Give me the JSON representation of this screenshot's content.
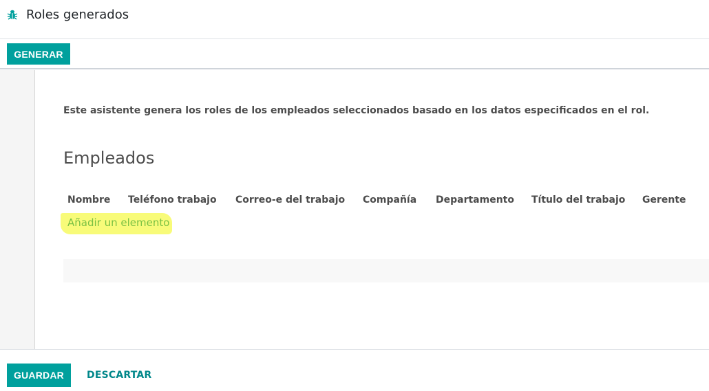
{
  "header": {
    "title": "Roles generados",
    "icon": "bug-icon",
    "icon_color": "#00a09d"
  },
  "toolbar": {
    "generate_label": "GENERAR"
  },
  "form": {
    "description": "Este asistente genera los roles de los empleados seleccionados basado en los datos especificados en el rol.",
    "section_title": "Empleados",
    "columns": [
      "Nombre",
      "Teléfono trabajo",
      "Correo-e del trabajo",
      "Compañía",
      "Departamento",
      "Título del trabajo",
      "Gerente"
    ],
    "add_item_label": "Añadir un elemento"
  },
  "footer": {
    "save_label": "GUARDAR",
    "discard_label": "DESCARTAR"
  },
  "colors": {
    "primary": "#00a09d",
    "link": "#00878a",
    "highlight": "#f7fb6a",
    "add_link": "#7ac144"
  }
}
